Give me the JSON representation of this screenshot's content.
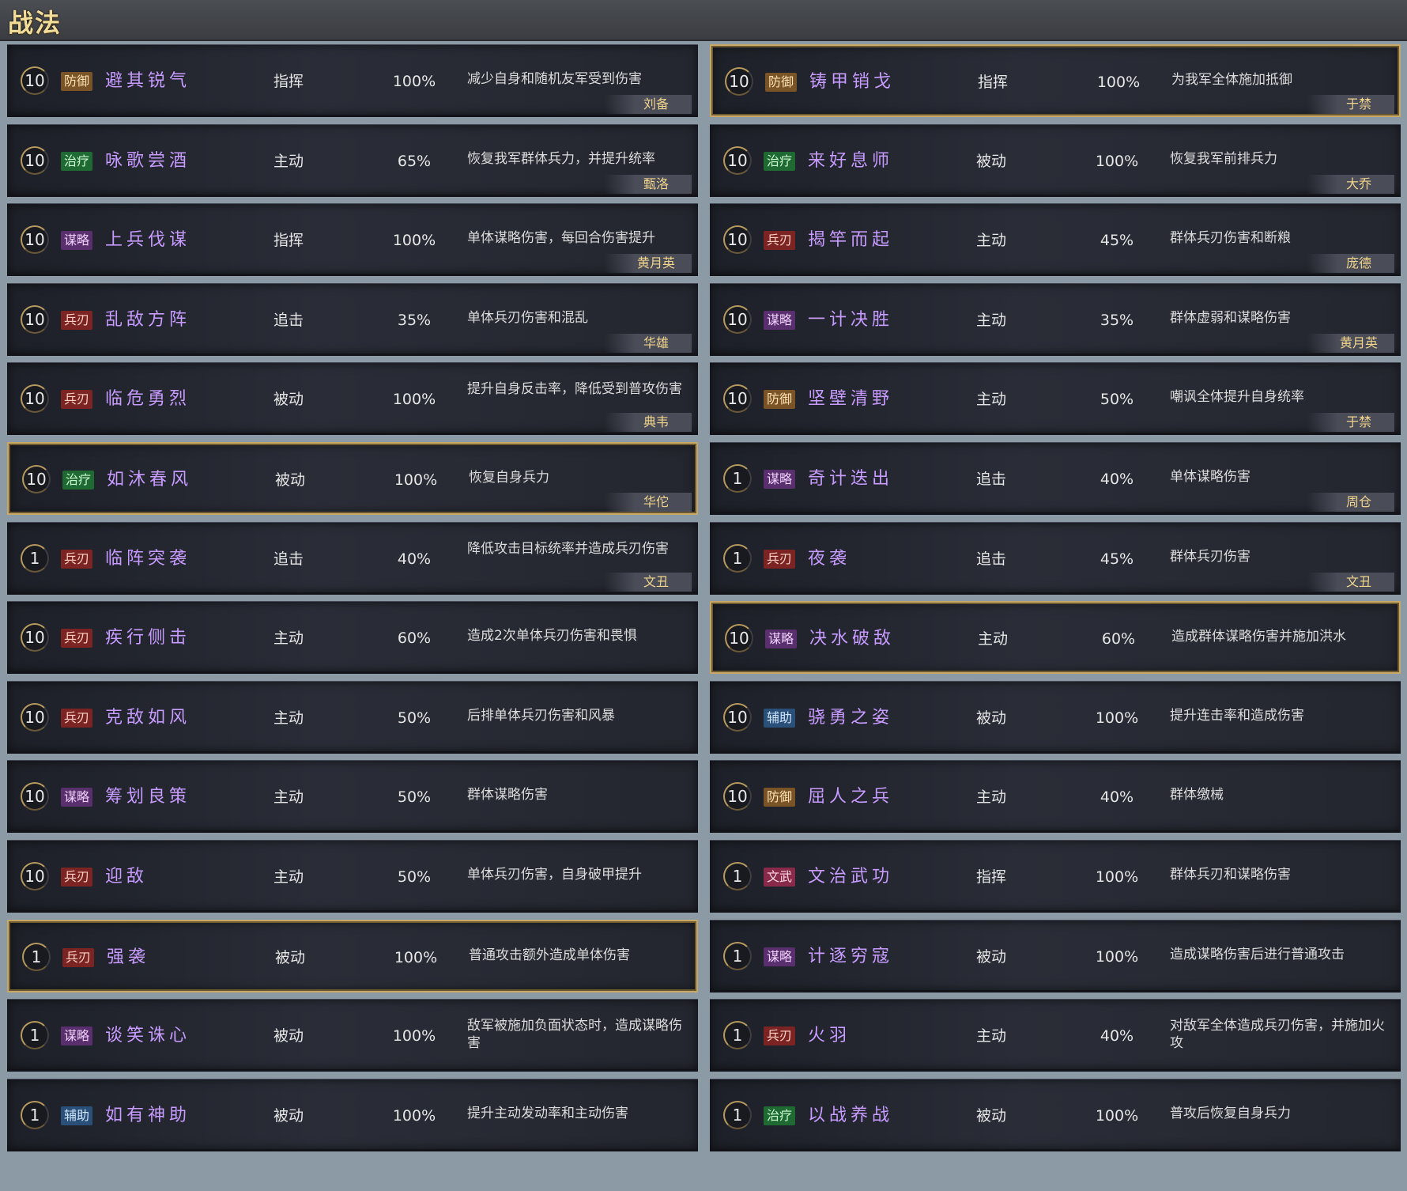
{
  "page": {
    "title": "战法"
  },
  "left": [
    {
      "level": "10",
      "category": "防御",
      "cat_class": "c-def",
      "name": "避其锐气",
      "type": "指挥",
      "rate": "100%",
      "desc": "减少自身和随机友军受到伤害",
      "hero": "刘备",
      "highlight": false,
      "two_line": false
    },
    {
      "level": "10",
      "category": "治疗",
      "cat_class": "c-heal",
      "name": "咏歌尝酒",
      "type": "主动",
      "rate": "65%",
      "desc": "恢复我军群体兵力，并提升统率",
      "hero": "甄洛",
      "highlight": false,
      "two_line": false
    },
    {
      "level": "10",
      "category": "谋略",
      "cat_class": "c-str",
      "name": "上兵伐谋",
      "type": "指挥",
      "rate": "100%",
      "desc": "单体谋略伤害，每回合伤害提升",
      "hero": "黄月英",
      "highlight": false,
      "two_line": false
    },
    {
      "level": "10",
      "category": "兵刃",
      "cat_class": "c-war",
      "name": "乱敌方阵",
      "type": "追击",
      "rate": "35%",
      "desc": "单体兵刃伤害和混乱",
      "hero": "华雄",
      "highlight": false,
      "two_line": false
    },
    {
      "level": "10",
      "category": "兵刃",
      "cat_class": "c-war",
      "name": "临危勇烈",
      "type": "被动",
      "rate": "100%",
      "desc": "提升自身反击率，降低受到普攻伤害",
      "hero": "典韦",
      "highlight": false,
      "two_line": true
    },
    {
      "level": "10",
      "category": "治疗",
      "cat_class": "c-heal",
      "name": "如沐春风",
      "type": "被动",
      "rate": "100%",
      "desc": "恢复自身兵力",
      "hero": "华佗",
      "highlight": true,
      "two_line": false
    },
    {
      "level": "1",
      "category": "兵刃",
      "cat_class": "c-war",
      "name": "临阵突袭",
      "type": "追击",
      "rate": "40%",
      "desc": "降低攻击目标统率并造成兵刃伤害",
      "hero": "文丑",
      "highlight": false,
      "two_line": true
    },
    {
      "level": "10",
      "category": "兵刃",
      "cat_class": "c-war",
      "name": "疾行侧击",
      "type": "主动",
      "rate": "60%",
      "desc": "造成2次单体兵刃伤害和畏惧",
      "hero": "",
      "highlight": false,
      "two_line": false
    },
    {
      "level": "10",
      "category": "兵刃",
      "cat_class": "c-war",
      "name": "克敌如风",
      "type": "主动",
      "rate": "50%",
      "desc": "后排单体兵刃伤害和风暴",
      "hero": "",
      "highlight": false,
      "two_line": false
    },
    {
      "level": "10",
      "category": "谋略",
      "cat_class": "c-str",
      "name": "筹划良策",
      "type": "主动",
      "rate": "50%",
      "desc": "群体谋略伤害",
      "hero": "",
      "highlight": false,
      "two_line": false
    },
    {
      "level": "10",
      "category": "兵刃",
      "cat_class": "c-war",
      "name": "迎敌",
      "type": "主动",
      "rate": "50%",
      "desc": "单体兵刃伤害，自身破甲提升",
      "hero": "",
      "highlight": false,
      "two_line": false
    },
    {
      "level": "1",
      "category": "兵刃",
      "cat_class": "c-war",
      "name": "强袭",
      "type": "被动",
      "rate": "100%",
      "desc": "普通攻击额外造成单体伤害",
      "hero": "",
      "highlight": true,
      "two_line": false
    },
    {
      "level": "1",
      "category": "谋略",
      "cat_class": "c-str",
      "name": "谈笑诛心",
      "type": "被动",
      "rate": "100%",
      "desc": "敌军被施加负面状态时，造成谋略伤害",
      "hero": "",
      "highlight": false,
      "two_line": true
    },
    {
      "level": "1",
      "category": "辅助",
      "cat_class": "c-aux",
      "name": "如有神助",
      "type": "被动",
      "rate": "100%",
      "desc": "提升主动发动率和主动伤害",
      "hero": "",
      "highlight": false,
      "two_line": false
    }
  ],
  "right": [
    {
      "level": "10",
      "category": "防御",
      "cat_class": "c-def",
      "name": "铸甲销戈",
      "type": "指挥",
      "rate": "100%",
      "desc": "为我军全体施加抵御",
      "hero": "于禁",
      "highlight": true,
      "two_line": false
    },
    {
      "level": "10",
      "category": "治疗",
      "cat_class": "c-heal",
      "name": "来好息师",
      "type": "被动",
      "rate": "100%",
      "desc": "恢复我军前排兵力",
      "hero": "大乔",
      "highlight": false,
      "two_line": false
    },
    {
      "level": "10",
      "category": "兵刃",
      "cat_class": "c-war",
      "name": "揭竿而起",
      "type": "主动",
      "rate": "45%",
      "desc": "群体兵刃伤害和断粮",
      "hero": "庞德",
      "highlight": false,
      "two_line": false
    },
    {
      "level": "10",
      "category": "谋略",
      "cat_class": "c-str",
      "name": "一计决胜",
      "type": "主动",
      "rate": "35%",
      "desc": "群体虚弱和谋略伤害",
      "hero": "黄月英",
      "highlight": false,
      "two_line": false
    },
    {
      "level": "10",
      "category": "防御",
      "cat_class": "c-def",
      "name": "坚壁清野",
      "type": "主动",
      "rate": "50%",
      "desc": "嘲讽全体提升自身统率",
      "hero": "于禁",
      "highlight": false,
      "two_line": false
    },
    {
      "level": "1",
      "category": "谋略",
      "cat_class": "c-str",
      "name": "奇计迭出",
      "type": "追击",
      "rate": "40%",
      "desc": "单体谋略伤害",
      "hero": "周仓",
      "highlight": false,
      "two_line": false
    },
    {
      "level": "1",
      "category": "兵刃",
      "cat_class": "c-war",
      "name": "夜袭",
      "type": "追击",
      "rate": "45%",
      "desc": "群体兵刃伤害",
      "hero": "文丑",
      "highlight": false,
      "two_line": false
    },
    {
      "level": "10",
      "category": "谋略",
      "cat_class": "c-str",
      "name": "决水破敌",
      "type": "主动",
      "rate": "60%",
      "desc": "造成群体谋略伤害并施加洪水",
      "hero": "",
      "highlight": true,
      "two_line": false
    },
    {
      "level": "10",
      "category": "辅助",
      "cat_class": "c-aux",
      "name": "骁勇之姿",
      "type": "被动",
      "rate": "100%",
      "desc": "提升连击率和造成伤害",
      "hero": "",
      "highlight": false,
      "two_line": false
    },
    {
      "level": "10",
      "category": "防御",
      "cat_class": "c-def",
      "name": "屈人之兵",
      "type": "主动",
      "rate": "40%",
      "desc": "群体缴械",
      "hero": "",
      "highlight": false,
      "two_line": false
    },
    {
      "level": "1",
      "category": "文武",
      "cat_class": "c-wenwu",
      "name": "文治武功",
      "type": "指挥",
      "rate": "100%",
      "desc": "群体兵刃和谋略伤害",
      "hero": "",
      "highlight": false,
      "two_line": false
    },
    {
      "level": "1",
      "category": "谋略",
      "cat_class": "c-str",
      "name": "计逐穷寇",
      "type": "被动",
      "rate": "100%",
      "desc": "造成谋略伤害后进行普通攻击",
      "hero": "",
      "highlight": false,
      "two_line": false
    },
    {
      "level": "1",
      "category": "兵刃",
      "cat_class": "c-war",
      "name": "火羽",
      "type": "主动",
      "rate": "40%",
      "desc": "对敌军全体造成兵刃伤害，并施加火攻",
      "hero": "",
      "highlight": false,
      "two_line": true
    },
    {
      "level": "1",
      "category": "治疗",
      "cat_class": "c-heal",
      "name": "以战养战",
      "type": "被动",
      "rate": "100%",
      "desc": "普攻后恢复自身兵力",
      "hero": "",
      "highlight": false,
      "two_line": false
    }
  ]
}
